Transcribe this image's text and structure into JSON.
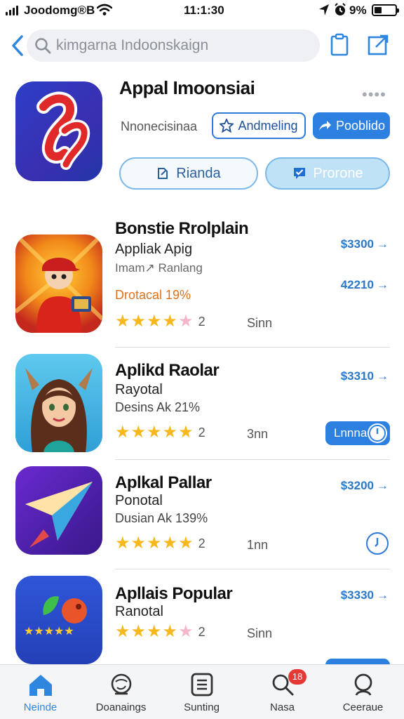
{
  "status_bar": {
    "carrier": "Joodomg®B",
    "time": "11:1:30",
    "battery_pct": "9%"
  },
  "search": {
    "placeholder": "kimgarna Indoonskaign"
  },
  "featured": {
    "title": "Appal Imoonsiai",
    "subtitle": "Nnonecisinaa",
    "outline_button": "Andmeling",
    "solid_button": "Pooblido",
    "pill_left": "Rianda",
    "pill_right": "Prorone"
  },
  "apps": [
    {
      "title": "Bonstie Rrolplain",
      "subtitle": "Appliak Apig",
      "category": "Imam↗ Ranlang",
      "discount": "Drotacal 19%",
      "rating": 4,
      "rating_count": "2",
      "size": "Sinn",
      "prices": [
        "$3300",
        "42210"
      ]
    },
    {
      "title": "Aplikd Raolar",
      "subtitle": "Rayotal",
      "category": "",
      "discount": "Desins Ak 21%",
      "rating": 5,
      "rating_count": "2",
      "size": "3nn",
      "prices": [
        "$3310"
      ],
      "action": "Lnnna"
    },
    {
      "title": "Aplkal Pallar",
      "subtitle": "Ponotal",
      "category": "",
      "discount": "Dusian Ak 139%",
      "rating": 5,
      "rating_count": "2",
      "size": "1nn",
      "prices": [
        "$3200"
      ]
    },
    {
      "title": "Apllais Popular",
      "subtitle": "Ranotal",
      "category": "",
      "discount": "",
      "rating": 4,
      "rating_count": "2",
      "size": "Sinn",
      "prices": [
        "$3330"
      ]
    }
  ],
  "tabs": [
    {
      "label": "Neinde",
      "icon": "home-icon",
      "active": true
    },
    {
      "label": "Doanaings",
      "icon": "globe-icon"
    },
    {
      "label": "Sunting",
      "icon": "list-icon"
    },
    {
      "label": "Nasa",
      "icon": "search-icon",
      "badge": "18"
    },
    {
      "label": "Ceeraue",
      "icon": "profile-icon"
    }
  ],
  "colors": {
    "accent": "#2b80e0",
    "star": "#f6b81c",
    "discount_orange": "#e0711b",
    "badge": "#e53935"
  }
}
